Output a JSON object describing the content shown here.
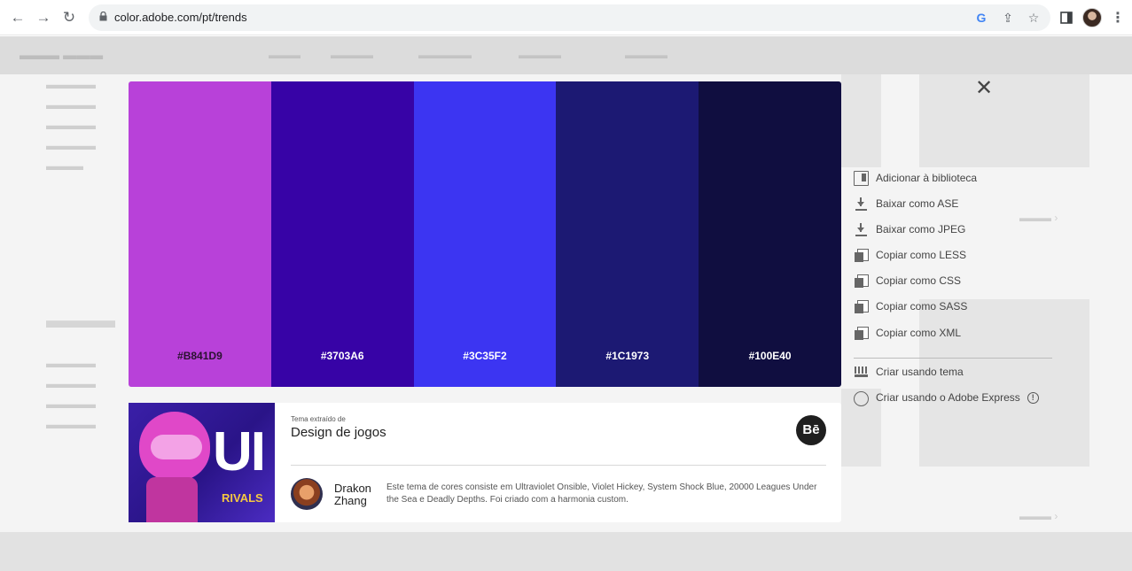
{
  "browser": {
    "url": "color.adobe.com/pt/trends"
  },
  "modal": {
    "swatches": [
      {
        "hex": "#B841D9",
        "color": "#B841D9",
        "text_color": "#2a1230"
      },
      {
        "hex": "#3703A6",
        "color": "#3703A6",
        "text_color": "#ffffff"
      },
      {
        "hex": "#3C35F2",
        "color": "#3C35F2",
        "text_color": "#ffffff"
      },
      {
        "hex": "#1C1973",
        "color": "#1C1973",
        "text_color": "#ffffff"
      },
      {
        "hex": "#100E40",
        "color": "#100E40",
        "text_color": "#ffffff"
      }
    ],
    "theme": {
      "small_label": "Tema extraído de",
      "title": "Design de jogos",
      "behance_label": "Bē"
    },
    "thumbnail": {
      "ui_text": "UI",
      "brand_text": "RIVALS"
    },
    "author": {
      "name": "Drakon Zhang"
    },
    "description": "Este tema de cores consiste em Ultraviolet Onsible, Violet Hickey, System Shock Blue, 20000 Leagues Under the Sea e Deadly Depths. Foi criado com a harmonia custom.",
    "actions": [
      {
        "label": "Adicionar à biblioteca",
        "icon": "library-icon"
      },
      {
        "label": "Baixar como ASE",
        "icon": "download-icon"
      },
      {
        "label": "Baixar como JPEG",
        "icon": "download-icon"
      },
      {
        "label": "Copiar como LESS",
        "icon": "copy-icon"
      },
      {
        "label": "Copiar como CSS",
        "icon": "copy-icon"
      },
      {
        "label": "Copiar como SASS",
        "icon": "copy-icon"
      },
      {
        "label": "Copiar como XML",
        "icon": "copy-icon"
      }
    ],
    "create_actions": [
      {
        "label": "Criar usando tema",
        "icon": "theme-icon"
      },
      {
        "label": "Criar usando o Adobe Express",
        "icon": "express-icon"
      }
    ]
  }
}
